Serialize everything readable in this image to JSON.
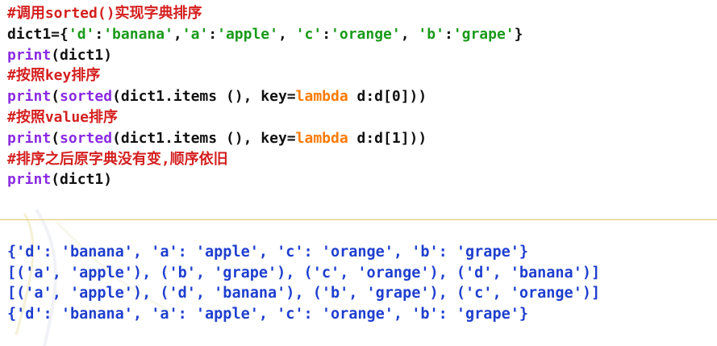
{
  "code": {
    "line1": "#调用sorted()实现字典排序",
    "line2_a": "dict1={",
    "line2_s1": "'d'",
    "line2_c1": ":",
    "line2_s2": "'banana'",
    "line2_c2": ",",
    "line2_s3": "'a'",
    "line2_c3": ":",
    "line2_s4": "'apple'",
    "line2_c4": ", ",
    "line2_s5": "'c'",
    "line2_c5": ":",
    "line2_s6": "'orange'",
    "line2_c6": ", ",
    "line2_s7": "'b'",
    "line2_c7": ":",
    "line2_s8": "'grape'",
    "line2_end": "}",
    "line3_fn": "print",
    "line3_rest": "(dict1)",
    "line4": "#按照key排序",
    "line5_fn": "print",
    "line5_p": "(",
    "line5_sorted": "sorted",
    "line5_mid": "(dict1.items (), key=",
    "line5_kw": "lambda",
    "line5_end": " d:d[0]))",
    "line6": "#按照value排序",
    "line7_fn": "print",
    "line7_p": "(",
    "line7_sorted": "sorted",
    "line7_mid": "(dict1.items (), key=",
    "line7_kw": "lambda",
    "line7_end": " d:d[1]))",
    "line8": "#排序之后原字典没有变,顺序依旧",
    "line9_fn": "print",
    "line9_rest": "(dict1)"
  },
  "output": {
    "line1": "{'d': 'banana', 'a': 'apple', 'c': 'orange', 'b': 'grape'}",
    "line2": "[('a', 'apple'), ('b', 'grape'), ('c', 'orange'), ('d', 'banana')]",
    "line3": "[('a', 'apple'), ('d', 'banana'), ('b', 'grape'), ('c', 'orange')]",
    "line4": "{'d': 'banana', 'a': 'apple', 'c': 'orange', 'b': 'grape'}"
  },
  "colors": {
    "comment": "#d42020",
    "builtin": "#8a2be2",
    "keyword": "#ff7a00",
    "string": "#1a9a1a",
    "output": "#1f3fcf",
    "separator": "#e3c766"
  }
}
